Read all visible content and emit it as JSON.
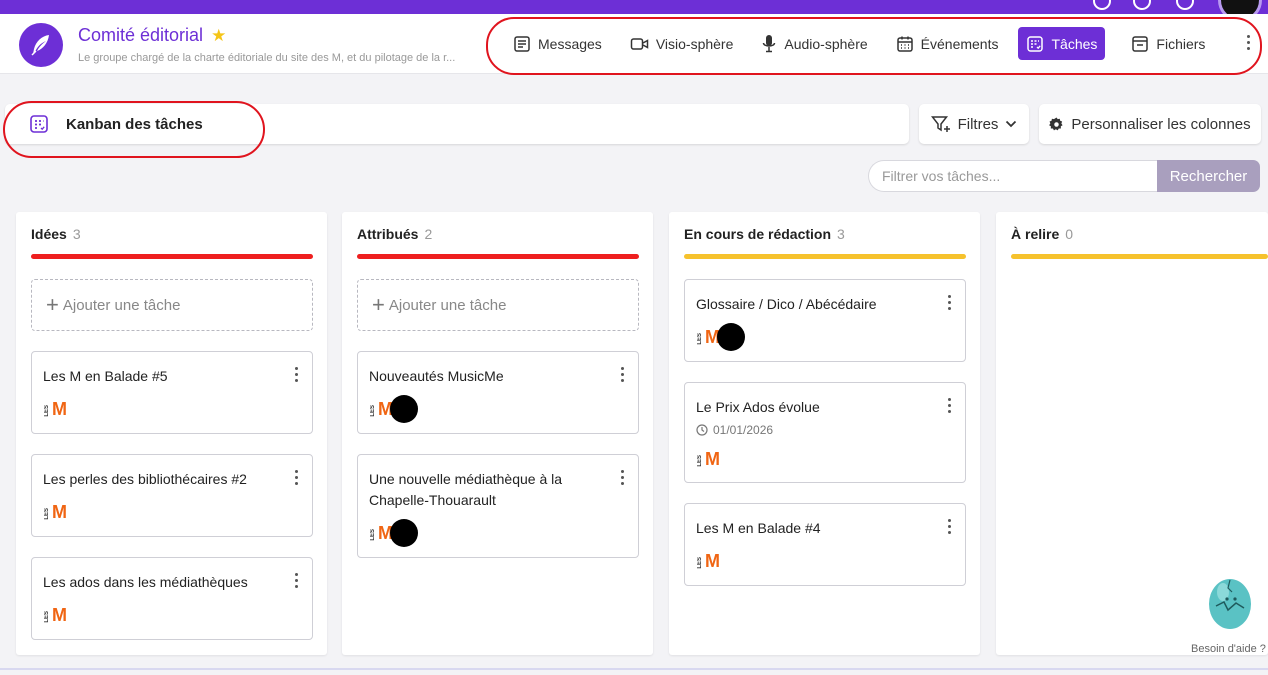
{
  "group": {
    "title": "Comité éditorial",
    "description": "Le groupe chargé de la charte éditoriale du site des M, et du pilotage de la r..."
  },
  "nav": [
    {
      "label": "Messages",
      "icon": "messages-icon",
      "active": false
    },
    {
      "label": "Visio-sphère",
      "icon": "video-icon",
      "active": false
    },
    {
      "label": "Audio-sphère",
      "icon": "microphone-icon",
      "active": false
    },
    {
      "label": "Événements",
      "icon": "calendar-icon",
      "active": false
    },
    {
      "label": "Tâches",
      "icon": "tasks-icon",
      "active": true
    },
    {
      "label": "Fichiers",
      "icon": "files-icon",
      "active": false
    }
  ],
  "kanban": {
    "title": "Kanban des tâches",
    "filters_label": "Filtres",
    "customize_label": "Personnaliser les colonnes"
  },
  "search": {
    "placeholder": "Filtrer vos tâches...",
    "button_label": "Rechercher"
  },
  "columns": [
    {
      "name": "Idées",
      "count": "3",
      "color": "#ee1f1f",
      "add_label": "Ajouter une tâche",
      "cards": [
        {
          "title": "Les M en Balade #5"
        },
        {
          "title": "Les perles des bibliothécaires #2"
        },
        {
          "title": "Les ados dans les médiathèques"
        }
      ]
    },
    {
      "name": "Attribués",
      "count": "2",
      "color": "#ee1f1f",
      "add_label": "Ajouter une tâche",
      "cards": [
        {
          "title": "Nouveautés MusicMe"
        },
        {
          "title": "Une nouvelle médiathèque à la Chapelle-Thouarault"
        }
      ]
    },
    {
      "name": "En cours de rédaction",
      "count": "3",
      "color": "#f6c22d",
      "cards": [
        {
          "title": "Glossaire / Dico / Abécédaire"
        },
        {
          "title": "Le Prix Ados évolue",
          "date": "01/01/2026"
        },
        {
          "title": "Les M en Balade #4"
        }
      ]
    },
    {
      "name": "À relire",
      "count": "0",
      "color": "#f6c22d",
      "cards": []
    }
  ],
  "logo_text": {
    "les": "LES",
    "m": "M"
  },
  "help": {
    "label": "Besoin d'aide ?"
  },
  "colors": {
    "accent": "#6d2fd6",
    "logo_orange": "#f06513",
    "search_button": "#a99fbe"
  }
}
